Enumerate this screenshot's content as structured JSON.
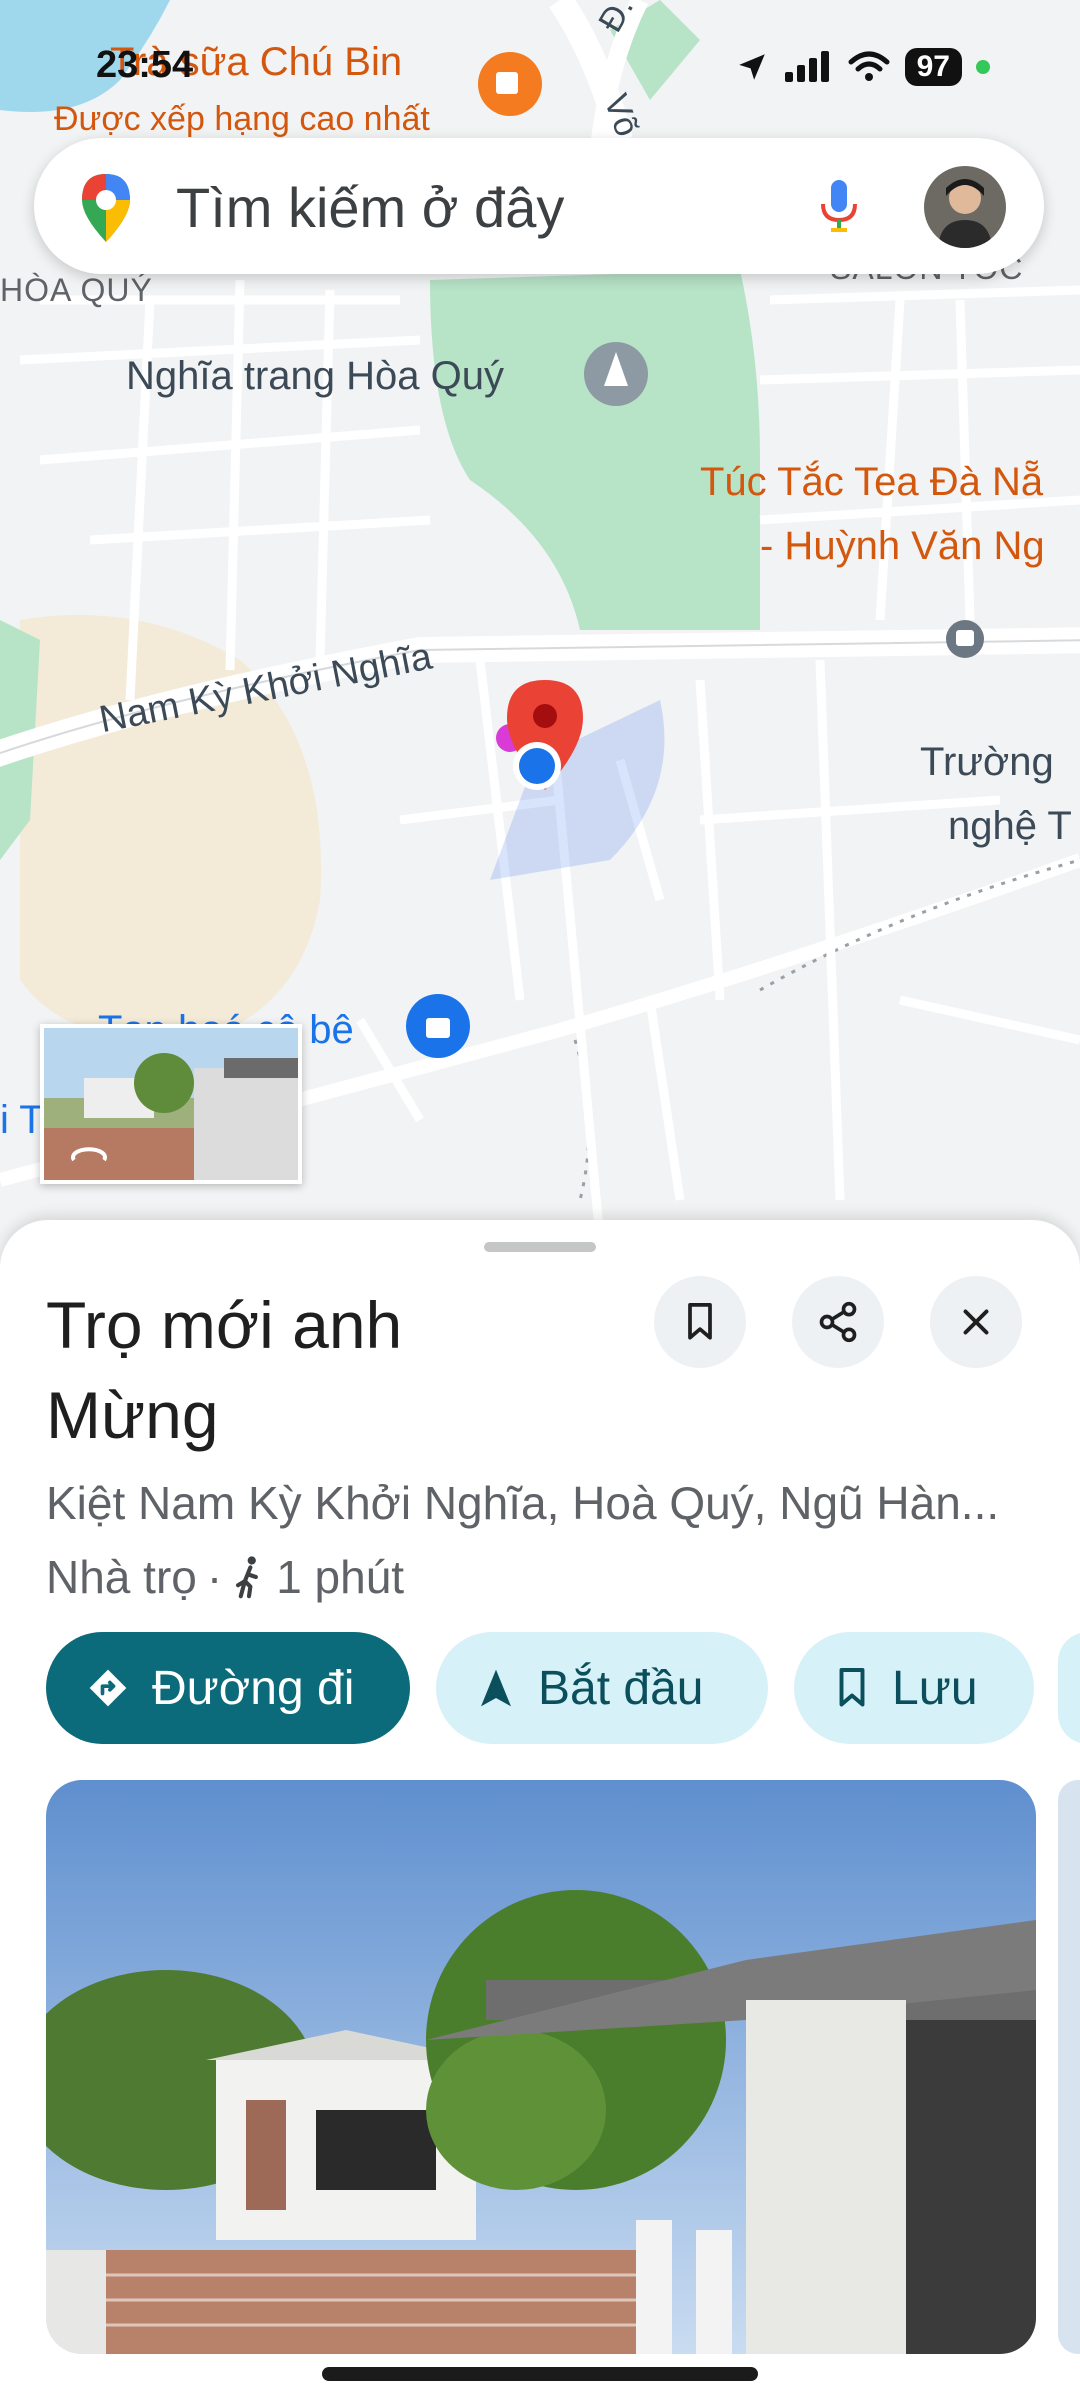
{
  "status_bar": {
    "time": "23:54",
    "battery": "97"
  },
  "search": {
    "placeholder": "Tìm kiếm ở đây",
    "maps_logo_icon": "google-maps-pin-icon",
    "mic_icon": "microphone-icon"
  },
  "map": {
    "labels": {
      "cafe_name": "Trà sữa Chú Bin",
      "cafe_sub": "Được xếp hạng cao nhất",
      "hoa_quy": "HÒA QUÝ",
      "salon": "SALON TÓC",
      "cemetery": "Nghĩa trang Hòa Quý",
      "tea_line1": "Túc Tắc Tea Đà Nẵ",
      "tea_line2": "- Huỳnh Văn Ng",
      "road": "Nam Kỳ Khởi Nghĩa",
      "school_line1": "Trường",
      "school_line2": "nghệ T",
      "shop": "Tạp hoá cô bê",
      "road_d": "Đ. N",
      "road_vo": "Võ",
      "edge_i": "i T"
    },
    "colors": {
      "park": "#b7e3c7",
      "road": "#ffffff",
      "pin": "#ea4335",
      "location": "#1a73e8"
    }
  },
  "place": {
    "title_line1": "Trọ mới anh",
    "title_line2": "Mừng",
    "address": "Kiệt Nam Kỳ Khởi Nghĩa, Hoà Quý, Ngũ Hàn...",
    "category": "Nhà trọ",
    "separator": "·",
    "walk_time": "1 phút"
  },
  "actions": {
    "directions": "Đường đi",
    "start": "Bắt đầu",
    "save": "Lưu"
  },
  "accent": {
    "primary": "#0b6b7a",
    "secondary_bg": "#d7f1f8"
  }
}
